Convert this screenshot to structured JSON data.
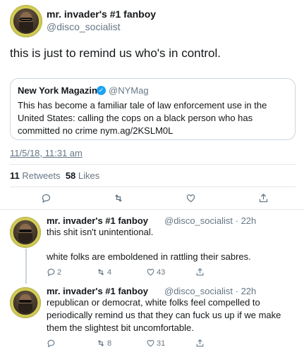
{
  "main_tweet": {
    "display_name": "mr. invader's #1 fanboy",
    "handle": "@disco_socialist",
    "text": "this is just to remind us who's in control.",
    "timestamp": "11/5/18, 11:31 am",
    "retweets": "11",
    "retweets_label": "Retweets",
    "likes": "58",
    "likes_label": "Likes"
  },
  "quoted_tweet": {
    "display_name": "New York Magazine",
    "verified_icon": "✓",
    "handle": "@NYMag",
    "text": "This has become a familiar tale of law enforcement use in the United States: calling the cops on a black person who has committed no crime nym.ag/2KSLM0L"
  },
  "replies": [
    {
      "display_name": "mr. invader's #1 fanboy",
      "meta": "@disco_socialist · 22h",
      "text_line1": "this shit isn't unintentional.",
      "text_line2": "white folks are emboldened in rattling their sabres.",
      "replies": "2",
      "retweets": "4",
      "likes": "43"
    },
    {
      "display_name": "mr. invader's #1 fanboy",
      "meta": "@disco_socialist · 22h",
      "text": "republican or democrat, white folks feel compelled to periodically remind us that they can fuck us up if we make them the slightest bit uncomfortable.",
      "retweets": "8",
      "likes": "31"
    }
  ],
  "icons": {
    "reply": "reply-icon",
    "retweet": "retweet-icon",
    "like": "heart-icon",
    "share": "share-icon"
  },
  "colors": {
    "accent": "#1da1f2",
    "muted": "#657786",
    "text": "#14171a",
    "border": "#e1e8ed"
  }
}
